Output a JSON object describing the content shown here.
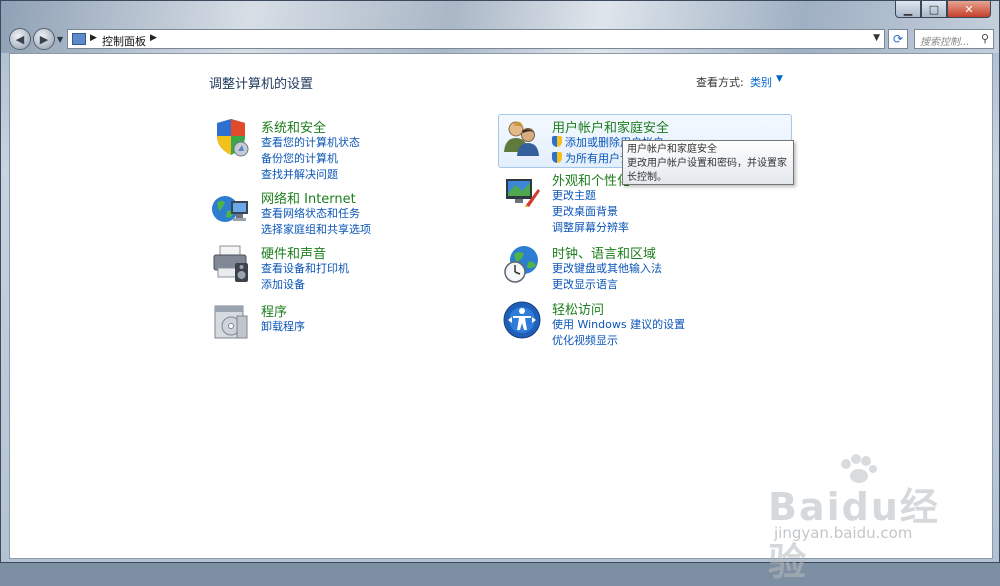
{
  "window": {
    "controls": {
      "minimize": "▁",
      "maximize": "□",
      "close": "✕"
    }
  },
  "navbar": {
    "breadcrumb": "控制面板",
    "search_placeholder": "搜索控制...",
    "refresh_icon": "refresh-icon"
  },
  "main": {
    "title": "调整计算机的设置",
    "view_by_label": "查看方式:",
    "view_by_value": "类别",
    "categories": [
      {
        "title": "系统和安全",
        "icon": "system-security-icon",
        "links": [
          "查看您的计算机状态",
          "备份您的计算机",
          "查找并解决问题"
        ]
      },
      {
        "title": "网络和 Internet",
        "icon": "network-icon",
        "links": [
          "查看网络状态和任务",
          "选择家庭组和共享选项"
        ]
      },
      {
        "title": "硬件和声音",
        "icon": "hardware-sound-icon",
        "links": [
          "查看设备和打印机",
          "添加设备"
        ]
      },
      {
        "title": "程序",
        "icon": "programs-icon",
        "links": [
          "卸载程序"
        ]
      },
      {
        "title": "用户帐户和家庭安全",
        "icon": "user-accounts-icon",
        "links": [
          "添加或删除用户帐户",
          "为所有用户设"
        ]
      },
      {
        "title": "外观和个性化",
        "icon": "appearance-icon",
        "links": [
          "更改主题",
          "更改桌面背景",
          "调整屏幕分辨率"
        ]
      },
      {
        "title": "时钟、语言和区域",
        "icon": "clock-language-icon",
        "links": [
          "更改键盘或其他输入法",
          "更改显示语言"
        ]
      },
      {
        "title": "轻松访问",
        "icon": "ease-of-access-icon",
        "links": [
          "使用 Windows 建议的设置",
          "优化视频显示"
        ]
      }
    ]
  },
  "tooltip": {
    "line1": "用户帐户和家庭安全",
    "line2": "更改用户帐户设置和密码，并设置家",
    "line3": "长控制。"
  },
  "watermark": {
    "text": "Baidu经验",
    "url": "jingyan.baidu.com"
  },
  "colors": {
    "category_title": "#1c7d1c",
    "link": "#0b56b7",
    "heading": "#1e395b"
  }
}
